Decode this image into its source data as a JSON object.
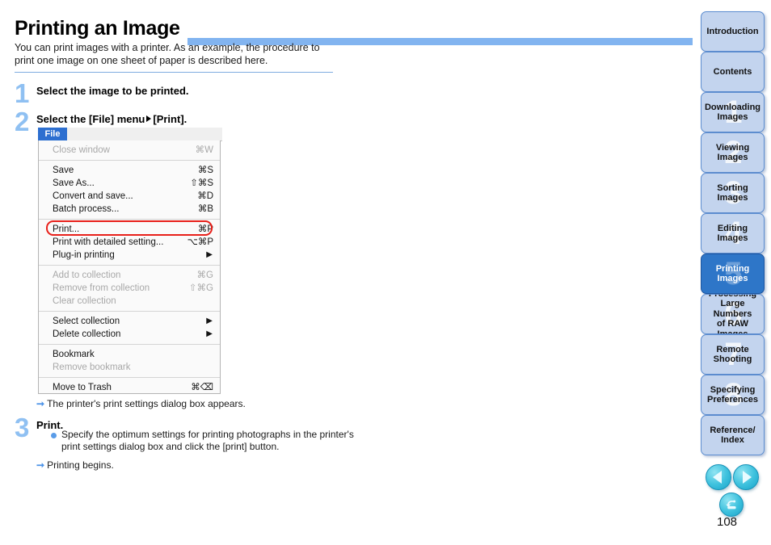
{
  "header": {
    "title": "Printing an Image",
    "accent_color": "#82B4F0"
  },
  "intro": {
    "text": "You can print images with a printer. As an example, the procedure to print one image on one sheet of paper is described here."
  },
  "steps": [
    {
      "number": "1",
      "title": "Select the image to be printed."
    },
    {
      "number": "2",
      "title_before": "Select the [File] menu",
      "title_after": "[Print]."
    },
    {
      "number": "3",
      "title": "Print.",
      "bullets": [
        "Specify the optimum settings for printing photographs in the printer's print settings dialog box and click the [print] button."
      ],
      "result": "Printing begins."
    }
  ],
  "menu_result": "The printer's print settings dialog box appears.",
  "menu": {
    "tab_label": "File",
    "highlight_color": "#E8201A",
    "groups": [
      {
        "items": [
          {
            "label": "Close window",
            "shortcut": "⌘W",
            "disabled": true,
            "submenu": false
          }
        ]
      },
      {
        "items": [
          {
            "label": "Save",
            "shortcut": "⌘S",
            "disabled": false,
            "submenu": false
          },
          {
            "label": "Save As...",
            "shortcut": "⇧⌘S",
            "disabled": false,
            "submenu": false
          },
          {
            "label": "Convert and save...",
            "shortcut": "⌘D",
            "disabled": false,
            "submenu": false
          },
          {
            "label": "Batch process...",
            "shortcut": "⌘B",
            "disabled": false,
            "submenu": false
          }
        ]
      },
      {
        "items": [
          {
            "label": "Print...",
            "shortcut": "⌘P",
            "disabled": false,
            "submenu": false,
            "highlighted": true
          },
          {
            "label": "Print with detailed setting...",
            "shortcut": "⌥⌘P",
            "disabled": false,
            "submenu": false
          },
          {
            "label": "Plug-in printing",
            "shortcut": "",
            "disabled": false,
            "submenu": true
          }
        ]
      },
      {
        "items": [
          {
            "label": "Add to collection",
            "shortcut": "⌘G",
            "disabled": true,
            "submenu": false
          },
          {
            "label": "Remove from collection",
            "shortcut": "⇧⌘G",
            "disabled": true,
            "submenu": false
          },
          {
            "label": "Clear collection",
            "shortcut": "",
            "disabled": true,
            "submenu": false
          }
        ]
      },
      {
        "items": [
          {
            "label": "Select collection",
            "shortcut": "",
            "disabled": false,
            "submenu": true
          },
          {
            "label": "Delete collection",
            "shortcut": "",
            "disabled": false,
            "submenu": true
          }
        ]
      },
      {
        "items": [
          {
            "label": "Bookmark",
            "shortcut": "",
            "disabled": false,
            "submenu": false
          },
          {
            "label": "Remove bookmark",
            "shortcut": "",
            "disabled": true,
            "submenu": false
          }
        ]
      },
      {
        "items": [
          {
            "label": "Move to Trash",
            "shortcut": "⌘⌫",
            "disabled": false,
            "submenu": false
          }
        ]
      }
    ]
  },
  "sidebar": {
    "active_color": "#2E76C8",
    "inactive_color": "#C3D4EE",
    "items": [
      {
        "label": "Introduction",
        "watermark": "",
        "active": false
      },
      {
        "label": "Contents",
        "watermark": "",
        "active": false
      },
      {
        "label": "Downloading\nImages",
        "watermark": "1",
        "active": false
      },
      {
        "label": "Viewing\nImages",
        "watermark": "2",
        "active": false
      },
      {
        "label": "Sorting\nImages",
        "watermark": "3",
        "active": false
      },
      {
        "label": "Editing\nImages",
        "watermark": "4",
        "active": false
      },
      {
        "label": "Printing\nImages",
        "watermark": "5",
        "active": true
      },
      {
        "label": "Processing\nLarge Numbers\nof RAW Images",
        "watermark": "6",
        "active": false
      },
      {
        "label": "Remote\nShooting",
        "watermark": "7",
        "active": false
      },
      {
        "label": "Specifying\nPreferences",
        "watermark": "8",
        "active": false
      },
      {
        "label": "Reference/\nIndex",
        "watermark": "",
        "active": false
      }
    ],
    "nav": {
      "prev_label": "Previous page",
      "next_label": "Next page",
      "back_label": "Back",
      "page_number": "108"
    }
  }
}
